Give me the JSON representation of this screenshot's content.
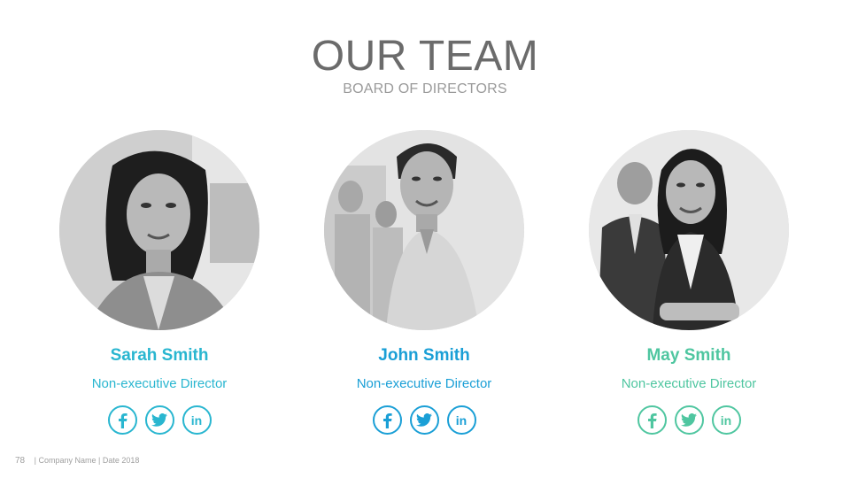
{
  "slide": {
    "title": "OUR TEAM",
    "subtitle": "BOARD OF DIRECTORS"
  },
  "members": [
    {
      "name": "Sarah Smith",
      "role": "Non-executive Director",
      "name_color": "#29b6d0",
      "accent": "#29b6d0",
      "socials": [
        "facebook-icon",
        "twitter-icon",
        "linkedin-icon"
      ]
    },
    {
      "name": "John Smith",
      "role": "Non-executive Director",
      "name_color": "#1a9fd6",
      "accent": "#1a9fd6",
      "socials": [
        "facebook-icon",
        "twitter-icon",
        "linkedin-icon"
      ]
    },
    {
      "name": "May Smith",
      "role": "Non-executive Director",
      "name_color": "#4fc6a0",
      "accent": "#4fc6a0",
      "socials": [
        "facebook-icon",
        "twitter-icon",
        "linkedin-icon"
      ]
    }
  ],
  "social_labels": {
    "linkedin": "in"
  },
  "footer": {
    "page_number": "78",
    "text": "| Company Name | Date 2018"
  }
}
